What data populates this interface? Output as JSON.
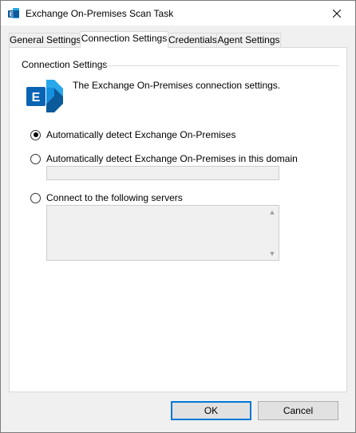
{
  "window": {
    "title": "Exchange On-Premises Scan Task",
    "icon": "exchange-app-icon",
    "close_icon": "close-icon"
  },
  "tabs": [
    {
      "label": "General Settings",
      "active": false
    },
    {
      "label": "Connection Settings",
      "active": true
    },
    {
      "label": "Credentials",
      "active": false
    },
    {
      "label": "Agent Settings",
      "active": false
    }
  ],
  "group": {
    "label": "Connection Settings",
    "icon": "exchange-icon",
    "description": "The Exchange On-Premises connection settings."
  },
  "options": [
    {
      "label": "Automatically detect Exchange On-Premises",
      "checked": true
    },
    {
      "label": "Automatically detect Exchange On-Premises in this domain",
      "checked": false
    },
    {
      "label": "Connect to the following servers",
      "checked": false
    }
  ],
  "domain_input": {
    "value": ""
  },
  "servers_list": {
    "items": []
  },
  "buttons": {
    "ok": "OK",
    "cancel": "Cancel"
  },
  "colors": {
    "accent": "#0078d7",
    "exchange_dark": "#0a5a9c",
    "exchange_light": "#28a8ea"
  }
}
